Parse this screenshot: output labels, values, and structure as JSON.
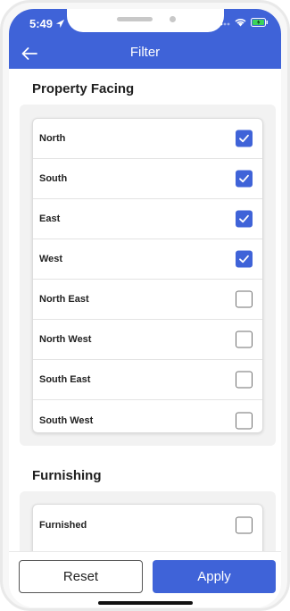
{
  "status_bar": {
    "time": "5:49"
  },
  "app_bar": {
    "title": "Filter"
  },
  "sections": [
    {
      "title": "Property Facing",
      "options": [
        {
          "label": "North",
          "checked": true
        },
        {
          "label": "South",
          "checked": true
        },
        {
          "label": "East",
          "checked": true
        },
        {
          "label": "West",
          "checked": true
        },
        {
          "label": "North East",
          "checked": false
        },
        {
          "label": "North West",
          "checked": false
        },
        {
          "label": "South East",
          "checked": false
        },
        {
          "label": "South West",
          "checked": false
        }
      ]
    },
    {
      "title": "Furnishing",
      "options": [
        {
          "label": "Furnished",
          "checked": false
        }
      ]
    }
  ],
  "actions": {
    "reset_label": "Reset",
    "apply_label": "Apply"
  },
  "colors": {
    "accent": "#3f63d8",
    "checkbox_border": "#6f6f6f",
    "section_bg": "#f2f2f2"
  }
}
